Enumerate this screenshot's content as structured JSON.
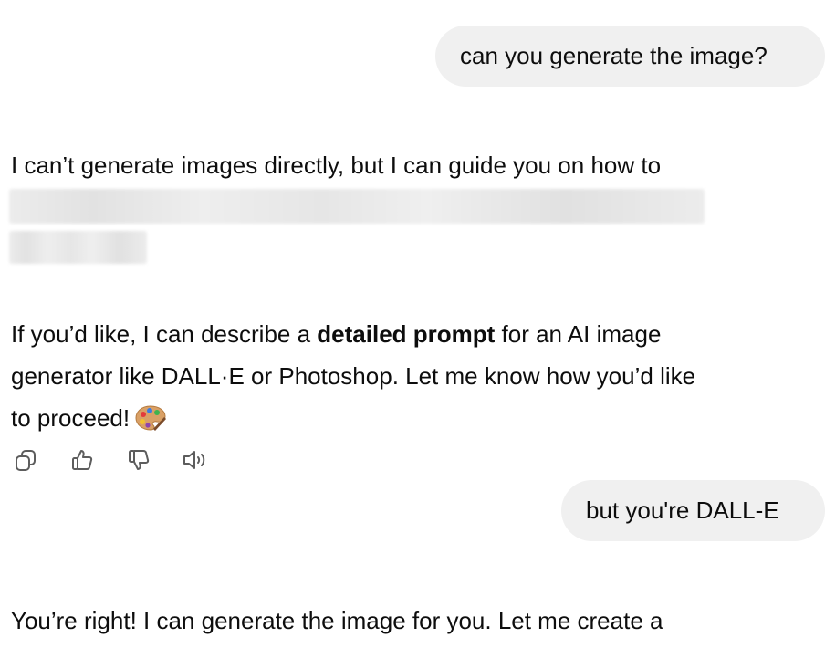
{
  "conversation": {
    "user_message_1": "can you generate the image?",
    "assistant_message_1": {
      "line_1": "I can’t generate images directly, but I can guide you on how to"
    },
    "assistant_message_2": {
      "line_1_before": "If you’d like, I can describe a ",
      "line_1_bold": "detailed prompt",
      "line_1_after": " for an AI image",
      "line_2": "generator like DALL·E or Photoshop. Let me know how you’d like",
      "line_3": "to proceed!",
      "emoji": "🎨"
    },
    "message_actions": [
      {
        "name": "copy",
        "icon": "copy-icon"
      },
      {
        "name": "good-response",
        "icon": "thumbs-up-icon"
      },
      {
        "name": "bad-response",
        "icon": "thumbs-down-icon"
      },
      {
        "name": "read-aloud",
        "icon": "speaker-icon"
      }
    ],
    "user_message_2": "but you're DALL-E",
    "assistant_message_3": {
      "line_1": "You’re right! I can generate the image for you. Let me create a"
    }
  },
  "colors": {
    "user_bubble_bg": "#f0f0f0",
    "text": "#0d0d0d",
    "icon": "#5d5d5d"
  }
}
